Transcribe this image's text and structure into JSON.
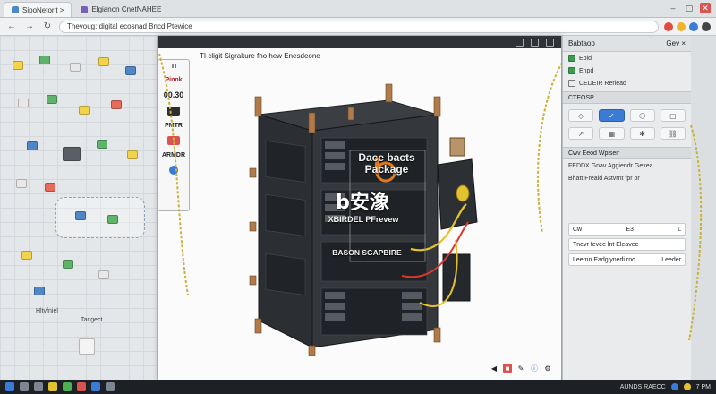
{
  "browser": {
    "tabs": [
      {
        "label": "SipoNetorit  >"
      },
      {
        "label": "Elgianon CnetNAHEE"
      }
    ],
    "address": "Thevoug: digital ecosnad Bncd Ptewice",
    "colors": {
      "accent": "#3a7bd5",
      "close": "#d9534f"
    }
  },
  "side_card": {
    "title": "TI",
    "label_red": "Pinnk",
    "value": "00.30",
    "label_2": "PMTR",
    "label_3": "ARMDR"
  },
  "preview": {
    "title": "TI cligit Sigrakure fno hew Enesdeone",
    "brand_line1": "Dace bacts",
    "brand_line2": "Package",
    "cn_text": "b安潒",
    "sub_text": "XBIRDEL PFrevew",
    "foot_text": "BASON SGAPBIRE"
  },
  "left_ws": {
    "caption_1": "Hltvfniel",
    "caption_2": "Tangect"
  },
  "inspector": {
    "header": "Babtaop",
    "header_right": "Gev  ×",
    "rows": [
      {
        "label": "Epid",
        "checked": true
      },
      {
        "label": "Enpd",
        "checked": true
      },
      {
        "label": "CEDEIR Rerlead",
        "checked": false
      }
    ],
    "section_1": "CTEOSP",
    "section_2": "Cwv Eeod Wpiseir",
    "notes": [
      "FEDDX  Gnav Aggiendr Gexea",
      "Bhatt  Freaid Astvrnt fpr or"
    ],
    "field_1": {
      "label": "Cw",
      "value": "E3",
      "extra": "L"
    },
    "field_2": {
      "label": "Tnevr fevee lnt Eleavee"
    },
    "field_3": {
      "label": "Leemn Eadgiynedi rnd",
      "value": "Leeder"
    }
  },
  "taskbar": {
    "clock": "AUNDS RAECC",
    "time": "7 PM"
  }
}
